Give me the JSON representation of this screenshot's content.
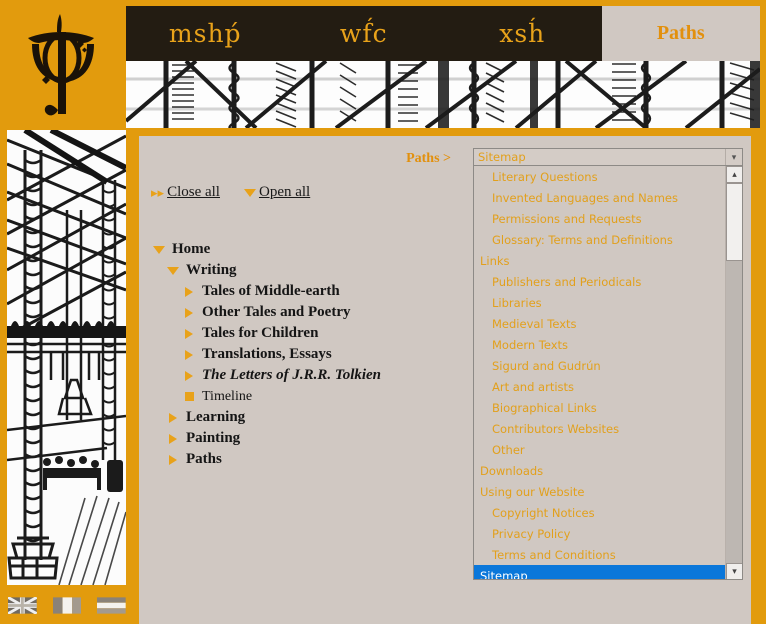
{
  "site": {
    "logo_alt": "J.R.R. Tolkien monogram",
    "accent_color": "#e29b0d",
    "dark_color": "#231c12",
    "content_bg": "#d0c8c2",
    "highlight_color": "#0a77da"
  },
  "nav": {
    "tabs": [
      {
        "label": "mshṕ",
        "script": "tengwar",
        "active": false
      },
      {
        "label": "wf́c",
        "script": "tengwar",
        "active": false
      },
      {
        "label": "xsh́",
        "script": "tengwar",
        "active": false
      },
      {
        "label": "Paths",
        "script": "latin",
        "active": true
      }
    ]
  },
  "breadcrumb": {
    "text": "Paths >"
  },
  "tree_controls": {
    "close_all": {
      "label": "Close all",
      "icon": "double-chevron-right-icon"
    },
    "open_all": {
      "label": "Open all",
      "icon": "triangle-down-icon"
    }
  },
  "tree": {
    "nodes": [
      {
        "label": "Home",
        "level": 0,
        "marker": "triangle-down-icon",
        "style": "bold"
      },
      {
        "label": "Writing",
        "level": 1,
        "marker": "triangle-down-icon",
        "style": "bold"
      },
      {
        "label": "Tales of Middle-earth",
        "level": 2,
        "marker": "triangle-right-icon",
        "style": "bold"
      },
      {
        "label": "Other Tales and Poetry",
        "level": 2,
        "marker": "triangle-right-icon",
        "style": "bold"
      },
      {
        "label": "Tales for Children",
        "level": 2,
        "marker": "triangle-right-icon",
        "style": "bold"
      },
      {
        "label": "Translations, Essays",
        "level": 2,
        "marker": "triangle-right-icon",
        "style": "bold"
      },
      {
        "label": "The Letters of J.R.R. Tolkien",
        "level": 2,
        "marker": "triangle-right-icon",
        "style": "bold-italic"
      },
      {
        "label": "Timeline",
        "level": 2,
        "marker": "square-icon",
        "style": "leaf"
      },
      {
        "label": "Learning",
        "level": 1,
        "marker": "triangle-right-icon",
        "style": "bold"
      },
      {
        "label": "Painting",
        "level": 1,
        "marker": "triangle-right-icon",
        "style": "bold"
      },
      {
        "label": "Paths",
        "level": 1,
        "marker": "triangle-right-icon",
        "style": "bold"
      }
    ]
  },
  "sitemap_select": {
    "selected_value": "Sitemap",
    "arrow_icon": "chevron-down-icon",
    "scroll_up_icon": "chevron-up-icon",
    "scroll_down_icon": "chevron-down-icon",
    "options": [
      {
        "label": "Literary Questions",
        "indent": true,
        "selected": false
      },
      {
        "label": "Invented Languages and Names",
        "indent": true,
        "selected": false
      },
      {
        "label": "Permissions and Requests",
        "indent": true,
        "selected": false
      },
      {
        "label": "Glossary: Terms and Definitions",
        "indent": true,
        "selected": false
      },
      {
        "label": "Links",
        "indent": false,
        "selected": false
      },
      {
        "label": "Publishers and Periodicals",
        "indent": true,
        "selected": false
      },
      {
        "label": "Libraries",
        "indent": true,
        "selected": false
      },
      {
        "label": "Medieval Texts",
        "indent": true,
        "selected": false
      },
      {
        "label": "Modern Texts",
        "indent": true,
        "selected": false
      },
      {
        "label": "Sigurd and Gudrún",
        "indent": true,
        "selected": false
      },
      {
        "label": "Art and artists",
        "indent": true,
        "selected": false
      },
      {
        "label": "Biographical Links",
        "indent": true,
        "selected": false
      },
      {
        "label": "Contributors Websites",
        "indent": true,
        "selected": false
      },
      {
        "label": "Other",
        "indent": true,
        "selected": false
      },
      {
        "label": "Downloads",
        "indent": false,
        "selected": false
      },
      {
        "label": "Using our Website",
        "indent": false,
        "selected": false
      },
      {
        "label": "Copyright Notices",
        "indent": true,
        "selected": false
      },
      {
        "label": "Privacy Policy",
        "indent": true,
        "selected": false
      },
      {
        "label": "Terms and Conditions",
        "indent": true,
        "selected": false
      },
      {
        "label": "Sitemap",
        "indent": false,
        "selected": true
      }
    ]
  },
  "language_flags": [
    {
      "name": "flag-united-kingdom",
      "title": "English"
    },
    {
      "name": "flag-italy",
      "title": "Italiano"
    },
    {
      "name": "flag-striped",
      "title": "Other"
    }
  ]
}
